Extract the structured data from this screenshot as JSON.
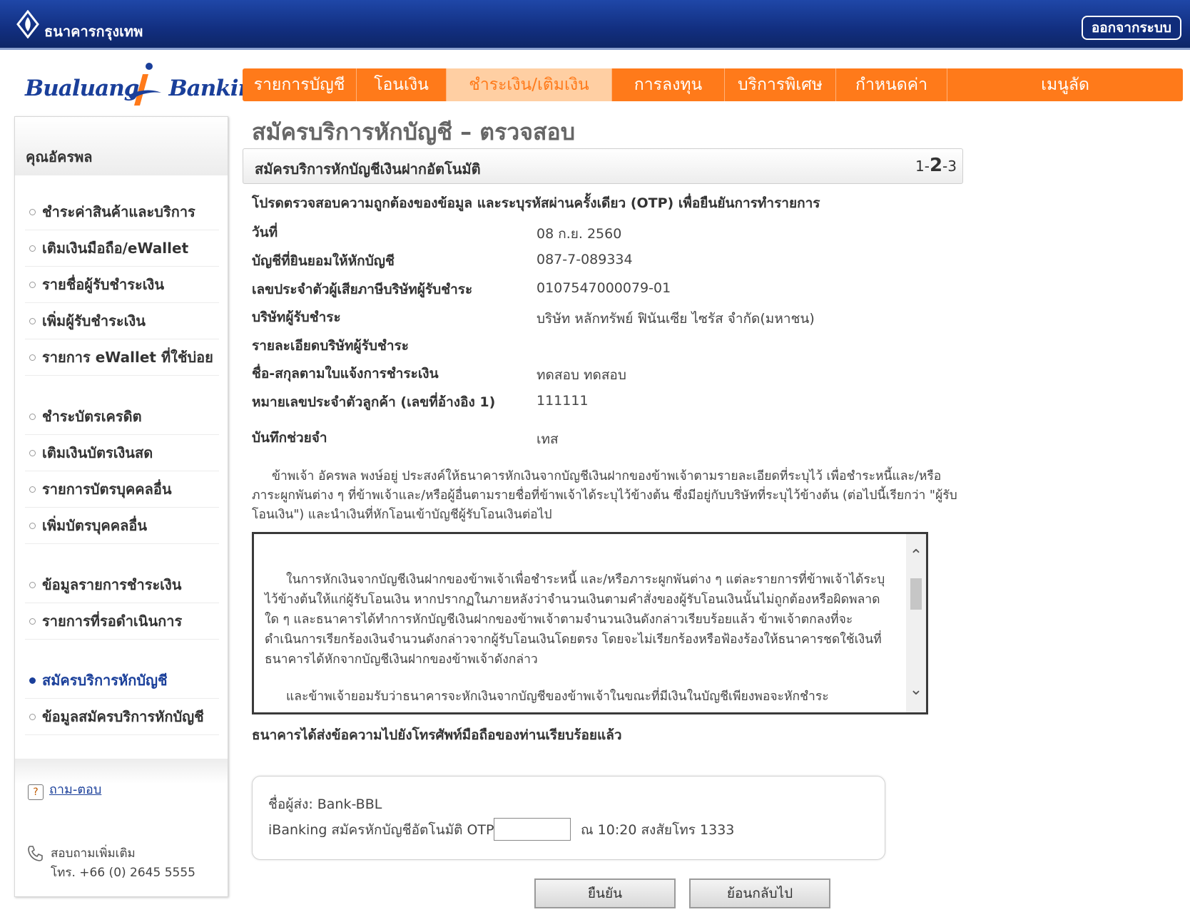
{
  "header": {
    "bank_name": "ธนาคารกรุงเทพ",
    "logout_label": "ออกจากระบบ",
    "brand_left": "Bualuang",
    "brand_right": "Banking"
  },
  "nav": {
    "items": [
      {
        "label": "รายการบัญชี"
      },
      {
        "label": "โอนเงิน"
      },
      {
        "label": "ชำระเงิน/เติมเงิน"
      },
      {
        "label": "การลงทุน"
      },
      {
        "label": "บริการพิเศษ"
      },
      {
        "label": "กำหนดค่า"
      },
      {
        "label": "เมนูลัด"
      }
    ],
    "active_index": 2
  },
  "sidebar": {
    "user_name": "คุณอัครพล",
    "groups": [
      [
        {
          "label": "ชำระค่าสินค้าและบริการ"
        },
        {
          "label": "เติมเงินมือถือ/eWallet"
        },
        {
          "label": "รายชื่อผู้รับชำระเงิน"
        },
        {
          "label": "เพิ่มผู้รับชำระเงิน"
        },
        {
          "label": "รายการ eWallet ที่ใช้บ่อย"
        }
      ],
      [
        {
          "label": "ชำระบัตรเครดิต"
        },
        {
          "label": "เติมเงินบัตรเงินสด"
        },
        {
          "label": "รายการบัตรบุคคลอื่น"
        },
        {
          "label": "เพิ่มบัตรบุคคลอื่น"
        }
      ],
      [
        {
          "label": "ข้อมูลรายการชำระเงิน"
        },
        {
          "label": "รายการที่รอดำเนินการ"
        }
      ],
      [
        {
          "label": "สมัครบริการหักบัญชี"
        },
        {
          "label": "ข้อมูลสมัครบริการหักบัญชี"
        }
      ]
    ],
    "active_label": "สมัครบริการหักบัญชี",
    "help_label": "ถาม-ตอบ",
    "contact_line1": "สอบถามเพิ่มเติม",
    "contact_line2": "โทร. +66 (0) 2645 5555"
  },
  "main": {
    "page_title": "สมัครบริการหักบัญชี – ตรวจสอบ",
    "section_title": "สมัครบริการหักบัญชีเงินฝากอัตโนมัติ",
    "step_prefix": "1-",
    "step_current": "2",
    "step_suffix": "-3",
    "instruction": "โปรดตรวจสอบความถูกต้องของข้อมูล และระบุรหัสผ่านครั้งเดียว (OTP) เพื่อยืนยันการทำรายการ",
    "details": [
      {
        "label": "วันที่",
        "value": "08 ก.ย. 2560"
      },
      {
        "label": "บัญชีที่ยินยอมให้หักบัญชี",
        "value": "087-7-089334"
      },
      {
        "label": "เลขประจำตัวผู้เสียภาษีบริษัทผู้รับชำระ",
        "value": "0107547000079-01"
      },
      {
        "label": "บริษัทผู้รับชำระ",
        "value": "บริษัท หลักทรัพย์ ฟินันเซีย ไซรัส จำกัด(มหาชน)"
      },
      {
        "label": "รายละเอียดบริษัทผู้รับชำระ",
        "value": ""
      },
      {
        "label": "ชื่อ-สกุลตามใบแจ้งการชำระเงิน",
        "value": "ทดสอบ ทดสอบ"
      },
      {
        "label": "หมายเลขประจำตัวลูกค้า (เลขที่อ้างอิง 1)",
        "value": "111111"
      },
      {
        "label": "บันทึกช่วยจำ",
        "value": "เทส"
      }
    ],
    "consent": "ข้าพเจ้า อัครพล พงษ์อยู่ ประสงค์ให้ธนาคารหักเงินจากบัญชีเงินฝากของข้าพเจ้าตามรายละเอียดที่ระบุไว้ เพื่อชำระหนี้และ/หรือภาระผูกพันต่าง ๆ ที่ข้าพเจ้าและ/หรือผู้อื่นตามรายชื่อที่ข้าพเจ้าได้ระบุไว้ข้างต้น ซึ่งมีอยู่กับบริษัทที่ระบุไว้ข้างต้น (ต่อไปนี้เรียกว่า \"ผู้รับโอนเงิน\") และนำเงินที่หักโอนเข้าบัญชีผู้รับโอนเงินต่อไป",
    "terms_p1": "ในการหักเงินจากบัญชีเงินฝากของข้าพเจ้าเพื่อชำระหนี้ และ/หรือภาระผูกพันต่าง ๆ แต่ละรายการที่ข้าพเจ้าได้ระบุไว้ข้างต้นให้แก่ผู้รับโอนเงิน หากปรากฏในภายหลังว่าจำนวนเงินตามคำสั่งของผู้รับโอนเงินนั้นไม่ถูกต้องหรือผิดพลาดใด ๆ และธนาคารได้ทำการหักบัญชีเงินฝากของข้าพเจ้าตามจำนวนเงินดังกล่าวเรียบร้อยแล้ว ข้าพเจ้าตกลงที่จะดำเนินการเรียกร้องเงินจำนวนดังกล่าวจากผู้รับโอนเงินโดยตรง โดยจะไม่เรียกร้องหรือฟ้องร้องให้ธนาคารชดใช้เงินที่ธนาคารได้หักจากบัญชีเงินฝากของข้าพเจ้าดังกล่าว",
    "terms_p2": "และข้าพเจ้ายอมรับว่าธนาคารจะหักเงินจากบัญชีของข้าพเจ้าในขณะที่มีเงินในบัญชีเพียงพอจะหักชำระ",
    "sms_sent": "ธนาคารได้ส่งข้อความไปยังโทรศัพท์มือถือของท่านเรียบร้อยแล้ว",
    "otp_sender": "ชื่อผู้ส่ง: Bank-BBL",
    "otp_label": "iBanking สมัครหักบัญชีอัตโนมัติ OTP",
    "otp_value": "",
    "otp_after": "ณ 10:20 สงสัยโทร 1333",
    "confirm_label": "ยืนยัน",
    "back_label": "ย้อนกลับไป"
  },
  "colors": {
    "header_blue": "#122f80",
    "nav_orange": "#ff7a1a",
    "nav_active_bg": "#ffcfa3",
    "brand_blue": "#1a3f9a"
  }
}
